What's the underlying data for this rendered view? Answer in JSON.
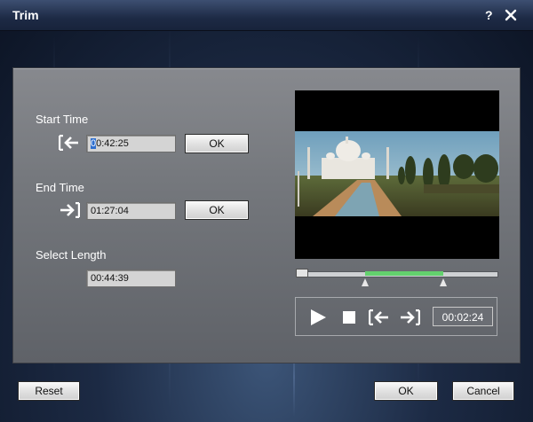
{
  "window": {
    "title": "Trim",
    "help_label": "?",
    "close_icon": "close-icon"
  },
  "start_time": {
    "label": "Start Time",
    "value": "00:42:25",
    "ok_label": "OK",
    "icon": "set-start-icon"
  },
  "end_time": {
    "label": "End Time",
    "value": "01:27:04",
    "ok_label": "OK",
    "icon": "set-end-icon"
  },
  "select_length": {
    "label": "Select Length",
    "value": "00:44:39"
  },
  "timeline": {
    "selection_start_fraction": 0.34,
    "selection_end_fraction": 0.73,
    "playhead_fraction": 0.0
  },
  "controls": {
    "play_icon": "play-icon",
    "stop_icon": "stop-icon",
    "set_start_icon": "set-start-icon",
    "set_end_icon": "set-end-icon",
    "current_time": "00:02:24"
  },
  "footer": {
    "reset_label": "Reset",
    "ok_label": "OK",
    "cancel_label": "Cancel"
  },
  "colors": {
    "selection": "#63d16d",
    "panel": "#7a7c81",
    "titlebar": "#2a3a5c"
  }
}
